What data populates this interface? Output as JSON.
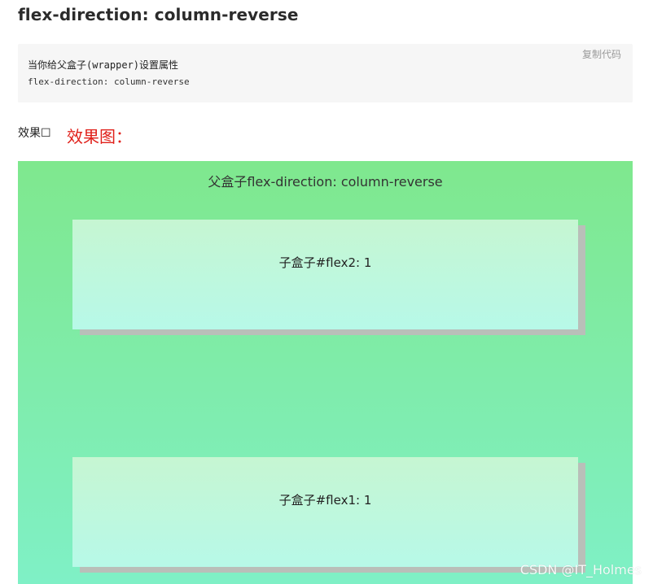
{
  "heading": "flex-direction: column-reverse",
  "code_block": {
    "line1": "当你给父盒子(wrapper)设置属性",
    "line2": "flex-direction: column-reverse",
    "copy_label": "复制代码"
  },
  "effect": {
    "text": "效果",
    "title": "效果图："
  },
  "demo": {
    "title": "父盒子flex-direction: column-reverse",
    "child_top_label": "子盒子#flex2: 1",
    "child_bottom_label": "子盒子#flex1: 1"
  },
  "watermark": "CSDN @IT_Holmes",
  "colors": {
    "accent_red": "#e0201a",
    "demo_green_top": "#7fe88e",
    "demo_green_bottom": "#7ff0c6"
  }
}
